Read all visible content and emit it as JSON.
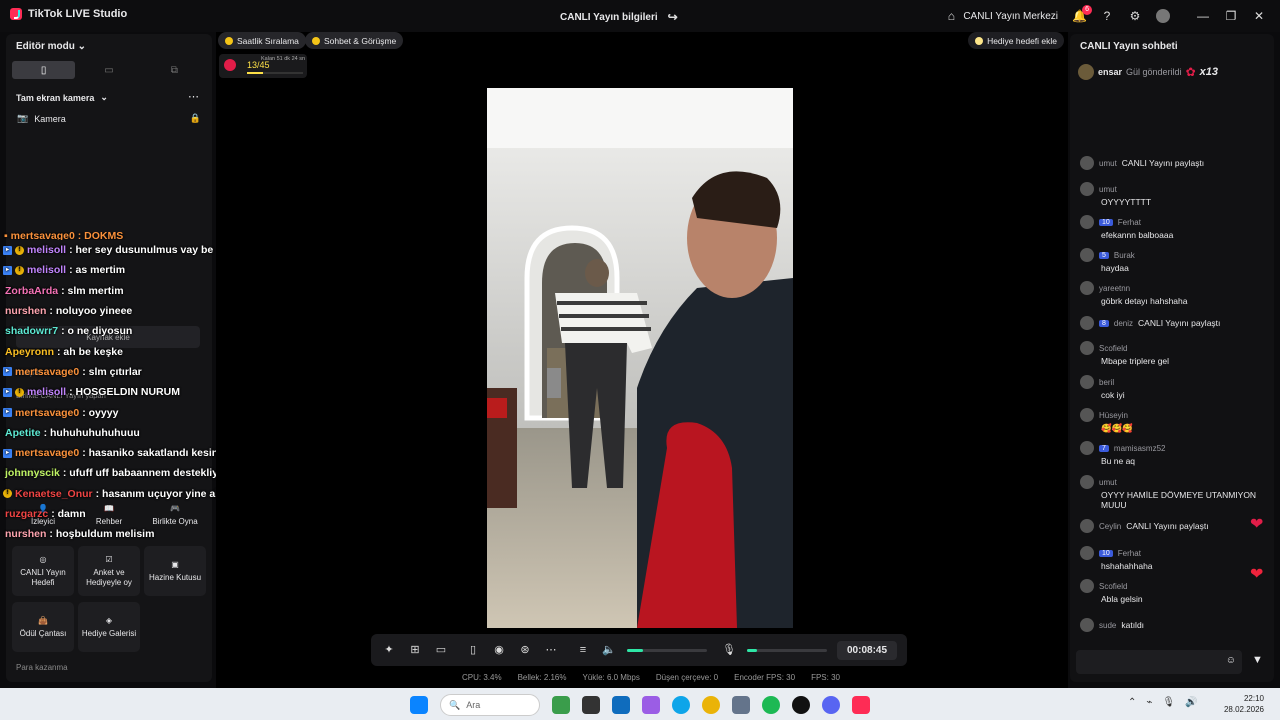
{
  "app": {
    "name": "TikTok LIVE Studio"
  },
  "header": {
    "stream_info": "CANLI Yayın bilgileri",
    "center_link": "CANLI Yayın Merkezi",
    "notif_count": "6"
  },
  "left": {
    "editor_mode": "Editör modu",
    "scene": "Tam ekran kamera",
    "source": "Kamera",
    "add_source": "Kaynak ekle",
    "tools": "Araçlar",
    "collab": "Birlikte CANLI Yayın yapan",
    "interaction": "Etkileşim",
    "buttons": [
      {
        "label": "İzleyici"
      },
      {
        "label": "Rehber"
      },
      {
        "label": "Birlikte Oyna"
      },
      {
        "label": "CANLI Yayın Hedefi"
      },
      {
        "label": "Anket ve Hediyeyle oy"
      },
      {
        "label": "Hazine Kutusu"
      },
      {
        "label": "Ödül Çantası"
      },
      {
        "label": "Hediye Galerisi"
      }
    ],
    "monetize": "Para kazanma"
  },
  "overlay_chat": [
    {
      "user": "melisoll",
      "text": ": her sey dusunulmus vay be",
      "color": "#c084fc",
      "tw": true,
      "lvl": true
    },
    {
      "user": "melisoll",
      "text": ": as mertim",
      "color": "#c084fc",
      "tw": true,
      "lvl": true
    },
    {
      "user": "ZorbaArda",
      "text": ": slm mertim",
      "color": "#f472b6",
      "tw": false,
      "lvl": false
    },
    {
      "user": "nurshen",
      "text": ": noluyoo yineee",
      "color": "#fda4af",
      "tw": false,
      "lvl": false
    },
    {
      "user": "shadowrr7",
      "text": ": o ne diyosun",
      "color": "#5eead4",
      "tw": false,
      "lvl": false
    },
    {
      "user": "Apeyronn",
      "text": ": ah be keşke",
      "color": "#fbbf24",
      "tw": false,
      "lvl": false
    },
    {
      "user": "mertsavage0",
      "text": ": slm çıtırlar",
      "color": "#fb923c",
      "tw": true,
      "lvl": false
    },
    {
      "user": "melisoll",
      "text": ": HOSGELDIN NURUM",
      "color": "#c084fc",
      "tw": true,
      "lvl": true
    },
    {
      "user": "mertsavage0",
      "text": ": oyyyy",
      "color": "#fb923c",
      "tw": true,
      "lvl": false
    },
    {
      "user": "Apetite",
      "text": ": huhuhuhuhuhuuu",
      "color": "#5eead4",
      "tw": false,
      "lvl": false
    },
    {
      "user": "mertsavage0",
      "text": ": hasaniko sakatlandı kesin",
      "color": "#fb923c",
      "tw": true,
      "lvl": false
    },
    {
      "user": "johnnyscik",
      "text": ": ufuff uff babaannem destekliyorr",
      "color": "#bef264",
      "tw": false,
      "lvl": false
    },
    {
      "user": "Kenaetse_Onur",
      "text": ": hasanım uçuyor yine ahahahahahah",
      "color": "#ef4444",
      "tw": false,
      "lvl": true
    },
    {
      "user": "ruzgarzc",
      "text": ": damn",
      "color": "#ef4444",
      "tw": false,
      "lvl": false
    },
    {
      "user": "nurshen",
      "text": ": hoşbuldum melisim",
      "color": "#fda4af",
      "tw": false,
      "lvl": false
    }
  ],
  "stage": {
    "pill1": "Saatlik Sıralama",
    "pill2": "Sohbet & Görüşme",
    "gift_goal": "Hediye hedefi ekle",
    "goal_count": "13/45",
    "goal_time": "Kalan 51 dk 24 sn",
    "goal_progress": 0.289
  },
  "controls": {
    "timer": "00:08:45",
    "volume": 0.2,
    "mic": 0.12
  },
  "stats": {
    "cpu": "CPU: 3.4%",
    "mem": "Bellek: 2.16%",
    "upload": "Yükle: 6.0 Mbps",
    "dropped": "Düşen çerçeve: 0",
    "enc_fps": "Encoder FPS: 30",
    "fps": "FPS: 30"
  },
  "right": {
    "title": "CANLI Yayın sohbeti",
    "gift_user": "ensar",
    "gift_text": "Gül gönderildi",
    "gift_count": "x13",
    "messages": [
      {
        "user": "umut",
        "text": "CANLI Yayını paylaştı",
        "inline": true,
        "lv": ""
      },
      {
        "user": "umut",
        "text": "OYYYYTTTT",
        "inline": false,
        "lv": ""
      },
      {
        "user": "Ferhat",
        "text": "efekannn balboaaa",
        "inline": false,
        "lv": "10"
      },
      {
        "user": "Burak",
        "text": "haydaa",
        "inline": false,
        "lv": "5"
      },
      {
        "user": "yareetnn",
        "text": "göbrk detayı hahshaha",
        "inline": false,
        "lv": ""
      },
      {
        "user": "deniz",
        "text": "CANLI Yayını paylaştı",
        "inline": true,
        "lv": "8"
      },
      {
        "user": "Scofield",
        "text": "Mbape triplere gel",
        "inline": false,
        "lv": ""
      },
      {
        "user": "beril",
        "text": "cok iyi",
        "inline": false,
        "lv": ""
      },
      {
        "user": "Hüseyin",
        "text": "🥰🥰🥰",
        "inline": false,
        "lv": ""
      },
      {
        "user": "mamisasmz52",
        "text": "Bu ne aq",
        "inline": false,
        "lv": "7"
      },
      {
        "user": "umut",
        "text": "OYYY HAMİLE DÖVMEYE UTANMIYON MUUU",
        "inline": false,
        "lv": ""
      },
      {
        "user": "Ceylin",
        "text": "CANLI Yayını paylaştı",
        "inline": true,
        "lv": ""
      },
      {
        "user": "Ferhat",
        "text": "hshahahhaha",
        "inline": false,
        "lv": "10"
      },
      {
        "user": "Scofield",
        "text": "Abla gelsin",
        "inline": false,
        "lv": ""
      },
      {
        "user": "sude",
        "text": "katıldı",
        "inline": true,
        "lv": ""
      }
    ]
  },
  "taskbar": {
    "search": "Ara",
    "time": "22:10",
    "date": "28.02.2026"
  }
}
